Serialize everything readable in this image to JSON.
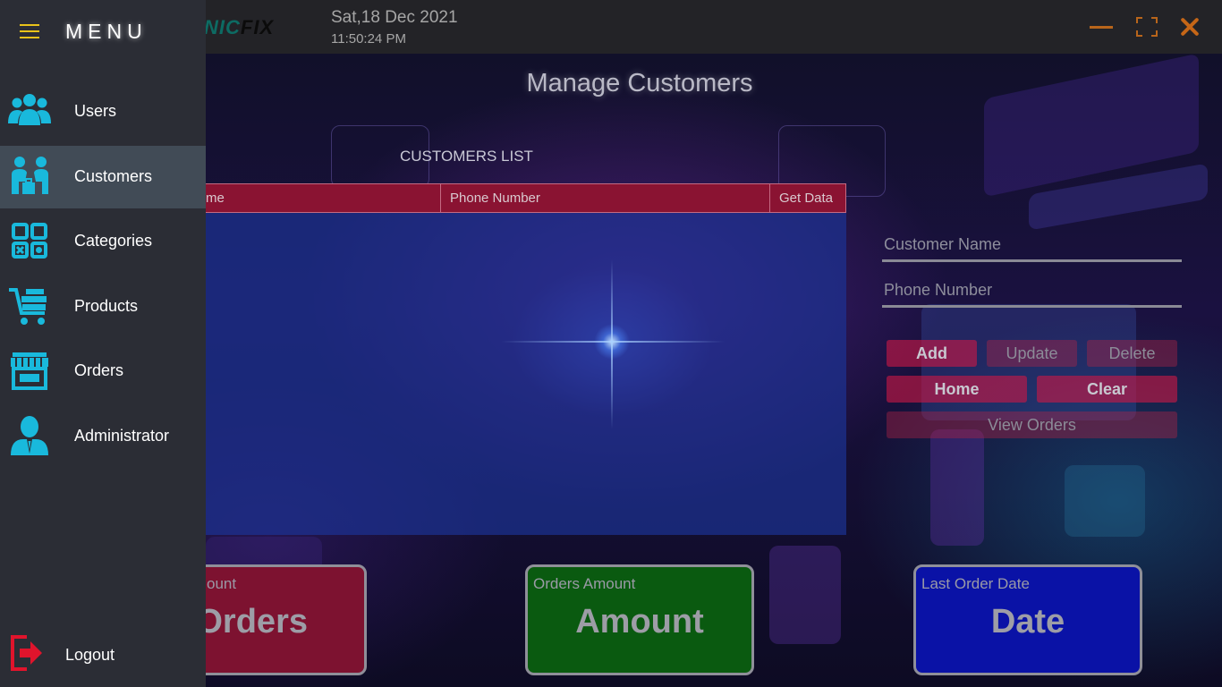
{
  "window": {
    "brand_part1": "NIC",
    "brand_part2": "FIX",
    "date": "Sat,18 Dec 2021",
    "time": "11:50:24 PM"
  },
  "page": {
    "title": "Manage Customers",
    "list_caption": "CUSTOMERS LIST"
  },
  "table": {
    "columns": [
      "me",
      "Phone Number",
      "Get Data"
    ],
    "rows": []
  },
  "form": {
    "customer_name_placeholder": "Customer Name",
    "phone_number_placeholder": "Phone Number",
    "buttons": {
      "add": "Add",
      "update": "Update",
      "delete": "Delete",
      "home": "Home",
      "clear": "Clear",
      "view_orders": "View Orders"
    }
  },
  "cards": [
    {
      "label": "ount",
      "value": "Orders",
      "color": "#7d1230"
    },
    {
      "label": "Orders Amount",
      "value": "Amount",
      "color": "#0a5a10"
    },
    {
      "label": "Last Order Date",
      "value": "Date",
      "color": "#0a12a6"
    }
  ],
  "sidebar": {
    "menu_title": "MENU",
    "items": [
      {
        "label": "Users",
        "icon": "users-icon",
        "active": false
      },
      {
        "label": "Customers",
        "icon": "customers-icon",
        "active": true
      },
      {
        "label": "Categories",
        "icon": "categories-icon",
        "active": false
      },
      {
        "label": "Products",
        "icon": "cart-icon",
        "active": false
      },
      {
        "label": "Orders",
        "icon": "store-icon",
        "active": false
      },
      {
        "label": "Administrator",
        "icon": "admin-icon",
        "active": false
      }
    ],
    "logout_label": "Logout"
  },
  "colors": {
    "accent_cyan": "#19b9dc",
    "sidebar_bg": "#2b2d35",
    "table_header": "#8a1332",
    "window_controls": "#b8651b",
    "logout_red": "#e0142c"
  }
}
